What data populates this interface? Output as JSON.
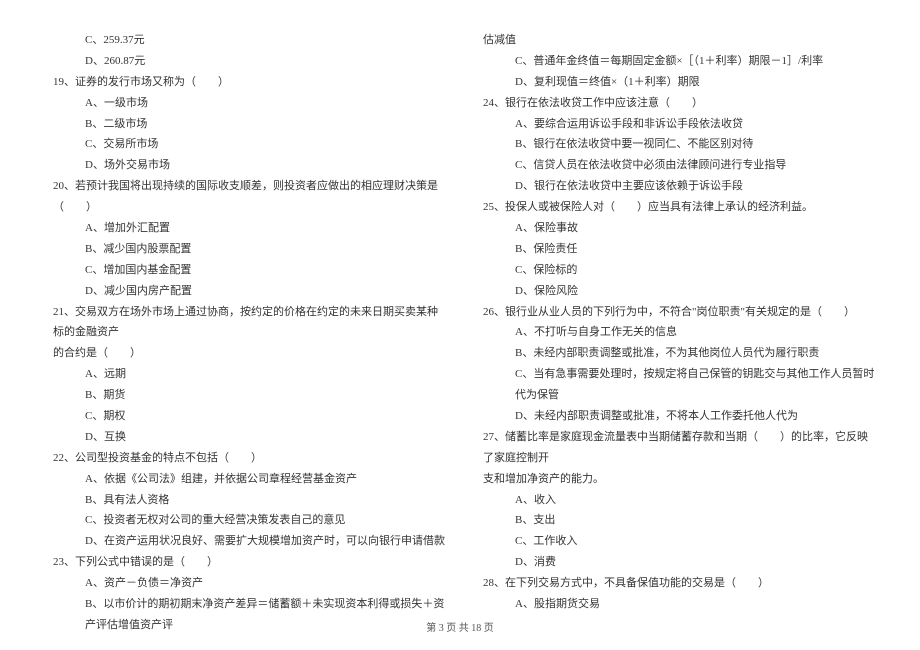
{
  "left": {
    "q18_options": [
      "C、259.37元",
      "D、260.87元"
    ],
    "q19": {
      "stem": "19、证券的发行市场又称为（　　）",
      "options": [
        "A、一级市场",
        "B、二级市场",
        "C、交易所市场",
        "D、场外交易市场"
      ]
    },
    "q20": {
      "stem": "20、若预计我国将出现持续的国际收支顺差，则投资者应做出的相应理财决策是（　　）",
      "options": [
        "A、增加外汇配置",
        "B、减少国内股票配置",
        "C、增加国内基金配置",
        "D、减少国内房产配置"
      ]
    },
    "q21": {
      "stem": "21、交易双方在场外市场上通过协商，按约定的价格在约定的未来日期买卖某种标的金融资产",
      "stem2": "的合约是（　　）",
      "options": [
        "A、远期",
        "B、期货",
        "C、期权",
        "D、互换"
      ]
    },
    "q22": {
      "stem": "22、公司型投资基金的特点不包括（　　）",
      "options": [
        "A、依据《公司法》组建，并依据公司章程经营基金资产",
        "B、具有法人资格",
        "C、投资者无权对公司的重大经营决策发表自己的意见",
        "D、在资产运用状况良好、需要扩大规模增加资产时，可以向银行申请借款"
      ]
    },
    "q23": {
      "stem": "23、下列公式中错误的是（　　）",
      "options": [
        "A、资产－负债＝净资产",
        "B、以市价计的期初期末净资产差异＝储蓄额＋未实现资本利得或损失＋资产评估增值资产评"
      ]
    }
  },
  "right": {
    "q23_cont": {
      "line1": "估减值",
      "options": [
        "C、普通年金终值＝每期固定金额×［（1＋利率）期限－1］/利率",
        "D、复利现值＝终值×（1＋利率）期限"
      ]
    },
    "q24": {
      "stem": "24、银行在依法收贷工作中应该注意（　　）",
      "options": [
        "A、要综合运用诉讼手段和非诉讼手段依法收贷",
        "B、银行在依法收贷中要一视同仁、不能区别对待",
        "C、信贷人员在依法收贷中必须由法律顾问进行专业指导",
        "D、银行在依法收贷中主要应该依赖于诉讼手段"
      ]
    },
    "q25": {
      "stem": "25、投保人或被保险人对（　　）应当具有法律上承认的经济利益。",
      "options": [
        "A、保险事故",
        "B、保险责任",
        "C、保险标的",
        "D、保险风险"
      ]
    },
    "q26": {
      "stem": "26、银行业从业人员的下列行为中，不符合\"岗位职责\"有关规定的是（　　）",
      "options": [
        "A、不打听与自身工作无关的信息",
        "B、未经内部职责调整或批准，不为其他岗位人员代为履行职责",
        "C、当有急事需要处理时，按规定将自己保管的钥匙交与其他工作人员暂时代为保管",
        "D、未经内部职责调整或批准，不将本人工作委托他人代为"
      ]
    },
    "q27": {
      "stem": "27、储蓄比率是家庭现金流量表中当期储蓄存款和当期（　　）的比率，它反映了家庭控制开",
      "stem2": "支和增加净资产的能力。",
      "options": [
        "A、收入",
        "B、支出",
        "C、工作收入",
        "D、消费"
      ]
    },
    "q28": {
      "stem": "28、在下列交易方式中，不具备保值功能的交易是（　　）",
      "options": [
        "A、股指期货交易"
      ]
    }
  },
  "footer": "第 3 页 共 18 页"
}
